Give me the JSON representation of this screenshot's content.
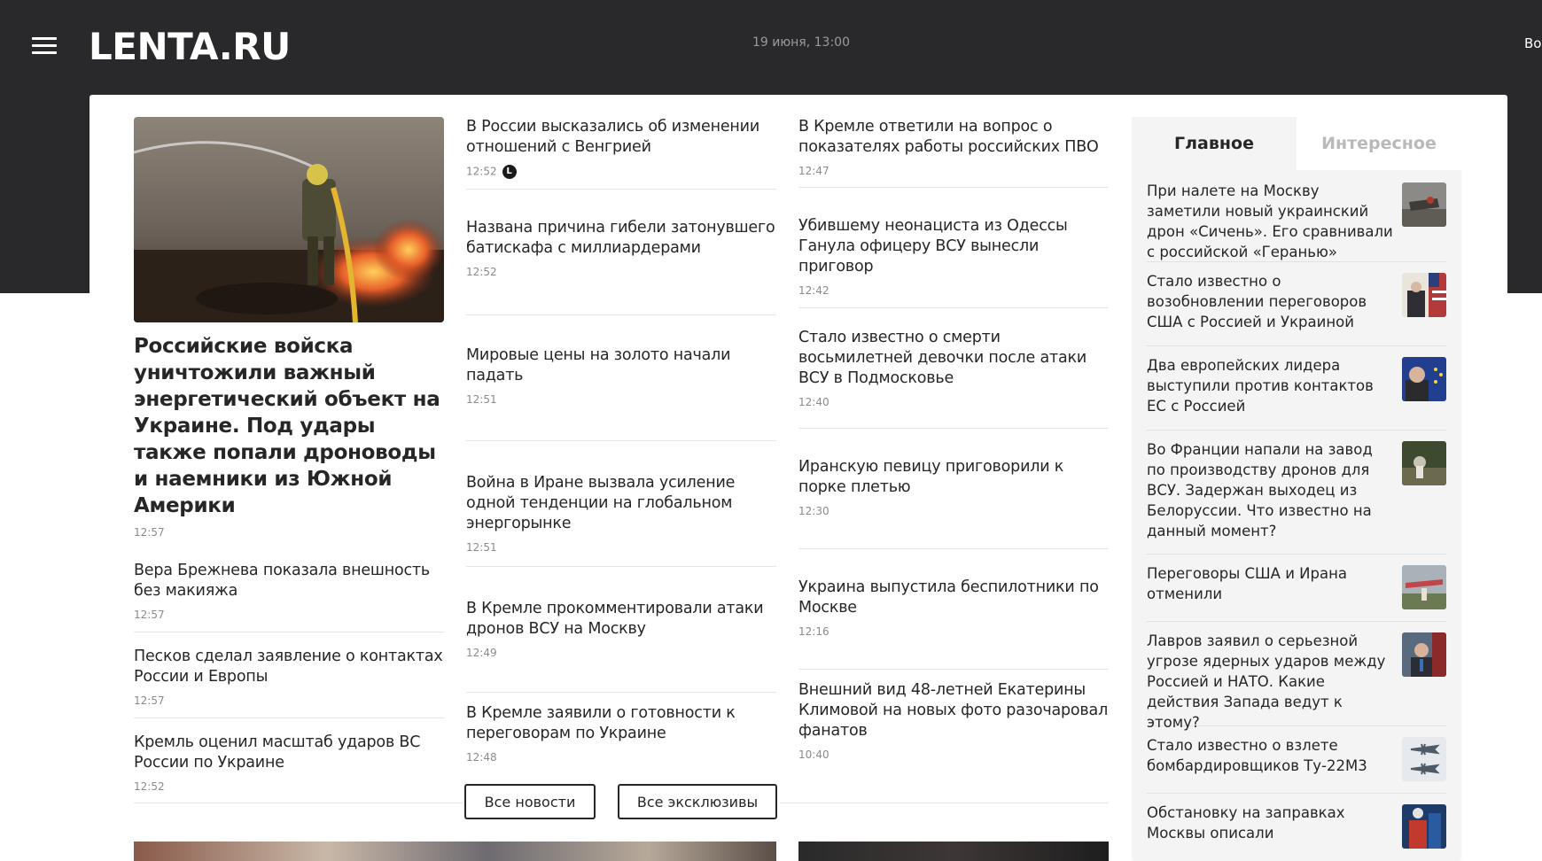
{
  "header": {
    "logo": "LENTA.RU",
    "date": "19 июня, 13:00",
    "auth_label": "Вой"
  },
  "lead": {
    "title": "Российские войска уничтожили важный энергетический объект на Украине. Под удары также попали дроноводы и наемники из Южной Америки",
    "time": "12:57"
  },
  "col_a": [
    {
      "title": "Вера Брежнева показала внешность без макияжа",
      "time": "12:57"
    },
    {
      "title": "Песков сделал заявление о контактах России и Европы",
      "time": "12:57"
    },
    {
      "title": "Кремль оценил масштаб ударов ВС России по Украине",
      "time": "12:52"
    }
  ],
  "col_b": [
    {
      "title": "В России высказались об изменении отношений с Венгрией",
      "time": "12:52",
      "badge": "L"
    },
    {
      "title": "Названа причина гибели затонувшего батискафа с миллиардерами",
      "time": "12:52"
    },
    {
      "title": "Мировые цены на золото начали падать",
      "time": "12:51"
    },
    {
      "title": "Война в Иране вызвала усиление одной тенденции на глобальном энергорынке",
      "time": "12:51"
    },
    {
      "title": "В Кремле прокомментировали атаки дронов ВСУ на Москву",
      "time": "12:49"
    },
    {
      "title": "В Кремле заявили о готовности к переговорам по Украине",
      "time": "12:48"
    }
  ],
  "col_c": [
    {
      "title": "В Кремле ответили на вопрос о показателях работы российских ПВО",
      "time": "12:47"
    },
    {
      "title": "Убившему неонациста из Одессы Ганула офицеру ВСУ вынесли приговор",
      "time": "12:42"
    },
    {
      "title": "Стало известно о смерти восьмилетней девочки после атаки ВСУ в Подмосковье",
      "time": "12:40"
    },
    {
      "title": "Иранскую певицу приговорили к порке плетью",
      "time": "12:30"
    },
    {
      "title": "Украина выпустила беспилотники по Москве",
      "time": "12:16"
    },
    {
      "title": "Внешний вид 48-летней Екатерины Климовой на новых фото разочаровал фанатов",
      "time": "10:40"
    }
  ],
  "buttons": {
    "all_news": "Все новости",
    "all_exclusives": "Все эксклюзивы"
  },
  "sidebar": {
    "tab_main": "Главное",
    "tab_interesting": "Интересное",
    "items": [
      {
        "title": "При налете на Москву заметили новый украинский дрон «Сичень». Его сравнивали с российской «Геранью»",
        "thumb": "drone-wreck-photo"
      },
      {
        "title": "Стало известно о возобновлении переговоров США с Россией и Украиной",
        "thumb": "us-flags-meeting-photo"
      },
      {
        "title": "Два европейских лидера выступили против контактов ЕС с Россией",
        "thumb": "eu-leader-photo"
      },
      {
        "title": "Во Франции напали на завод по производству дронов для ВСУ. Задержан выходец из Белоруссии. Что известно на данный момент?",
        "thumb": "factory-site-photo"
      },
      {
        "title": "Переговоры США и Ирана отменили",
        "thumb": "aircraft-photo"
      },
      {
        "title": "Лавров заявил о серьезной угрозе ядерных ударов между Россией и НАТО. Какие действия Запада ведут к этому?",
        "thumb": "lavrov-photo"
      },
      {
        "title": "Стало известно о взлете бомбардировщиков Ту-22М3",
        "thumb": "bombers-photo"
      },
      {
        "title": "Обстановку на заправках Москвы описали",
        "thumb": "fuel-station-photo"
      }
    ]
  }
}
